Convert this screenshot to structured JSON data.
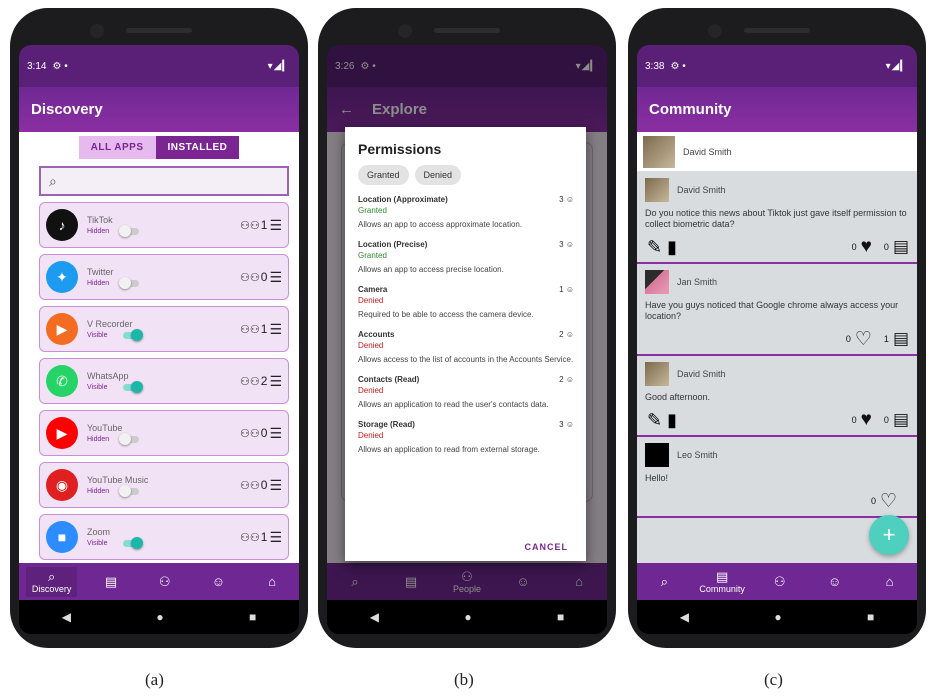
{
  "phone_a": {
    "status_time": "3:14",
    "status_icons": "⚙ •",
    "status_right": "▾◢▎",
    "title": "Discovery",
    "segment_all": "ALL APPS",
    "segment_installed": "INSTALLED",
    "search_icon": "⌕",
    "apps": [
      {
        "name": "TikTok",
        "visibility": "Hidden",
        "on": false,
        "count": "1",
        "icon": "♪",
        "color": "#111111"
      },
      {
        "name": "Twitter",
        "visibility": "Hidden",
        "on": false,
        "count": "0",
        "icon": "✦",
        "color": "#1d9bf0"
      },
      {
        "name": "V Recorder",
        "visibility": "Visible",
        "on": true,
        "count": "1",
        "icon": "▶",
        "color": "#f46b22"
      },
      {
        "name": "WhatsApp",
        "visibility": "Visible",
        "on": true,
        "count": "2",
        "icon": "✆",
        "color": "#25d366"
      },
      {
        "name": "YouTube",
        "visibility": "Hidden",
        "on": false,
        "count": "0",
        "icon": "▶",
        "color": "#ff0000"
      },
      {
        "name": "YouTube Music",
        "visibility": "Hidden",
        "on": false,
        "count": "0",
        "icon": "◉",
        "color": "#e02020"
      },
      {
        "name": "Zoom",
        "visibility": "Visible",
        "on": true,
        "count": "1",
        "icon": "■",
        "color": "#2d8cff"
      }
    ],
    "nav_active_label": "Discovery"
  },
  "phone_b": {
    "status_time": "3:26",
    "status_icons": "⚙ •",
    "status_right": "▾◢▎",
    "title": "Explore",
    "dialog_title": "Permissions",
    "chip_granted": "Granted",
    "chip_denied": "Denied",
    "permissions": [
      {
        "name": "Location (Approximate)",
        "status": "Granted",
        "count": "3",
        "desc": "Allows an app to access approximate location."
      },
      {
        "name": "Location (Precise)",
        "status": "Granted",
        "count": "3",
        "desc": "Allows an app to access precise location."
      },
      {
        "name": "Camera",
        "status": "Denied",
        "count": "1",
        "desc": "Required to be able to access the camera device."
      },
      {
        "name": "Accounts",
        "status": "Denied",
        "count": "2",
        "desc": "Allows access to the list of accounts in the Accounts Service."
      },
      {
        "name": "Contacts (Read)",
        "status": "Denied",
        "count": "2",
        "desc": "Allows an application to read the user's contacts data."
      },
      {
        "name": "Storage (Read)",
        "status": "Denied",
        "count": "3",
        "desc": "Allows an application to read from external storage."
      }
    ],
    "cancel": "CANCEL",
    "nav_active_label": "People"
  },
  "phone_c": {
    "status_time": "3:38",
    "status_icons": "⚙ •",
    "status_right": "▾◢▎",
    "title": "Community",
    "current_user": "David Smith",
    "posts": [
      {
        "author": "David Smith",
        "text": "Do you notice this news about Tiktok just gave itself permission to collect biometric data?",
        "likes": "0",
        "comments": "0",
        "liked": true,
        "own": true,
        "avatar": "photo"
      },
      {
        "author": "Jan Smith",
        "text": "Have you guys noticed that Google chrome always access your location?",
        "likes": "0",
        "comments": "1",
        "liked": false,
        "own": false,
        "avatar": "cartoon"
      },
      {
        "author": "David Smith",
        "text": "Good afternoon.",
        "likes": "0",
        "comments": "0",
        "liked": true,
        "own": true,
        "avatar": "photo"
      },
      {
        "author": "Leo Smith",
        "text": "Hello!",
        "likes": "0",
        "comments": "",
        "liked": false,
        "own": false,
        "avatar": "black"
      }
    ],
    "fab": "+",
    "nav_active_label": "Community"
  },
  "captions": [
    "(a)",
    "(b)",
    "(c)"
  ],
  "nav_icons": {
    "search": "⌕",
    "feed": "▤",
    "people": "⚇",
    "person": "☺",
    "home": "⌂"
  },
  "sys_nav": {
    "back": "◀",
    "home": "●",
    "recents": "■"
  }
}
